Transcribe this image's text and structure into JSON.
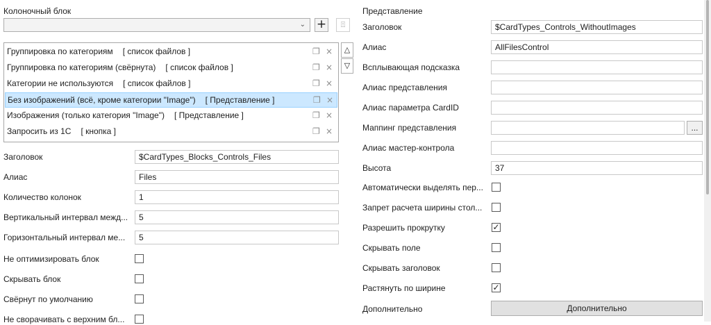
{
  "left": {
    "section_title": "Колоночный блок",
    "combo_value": "",
    "add_icon": "plus-icon",
    "import_icon": "import-icon",
    "move_up_icon": "arrow-up-icon",
    "move_down_icon": "arrow-down-icon",
    "list_items": [
      {
        "name": "Группировка по категориям",
        "tag": "[ список файлов ]",
        "selected": false
      },
      {
        "name": "Группировка по категориям (свёрнута)",
        "tag": "[ список файлов ]",
        "selected": false
      },
      {
        "name": "Категории не используются",
        "tag": "[ список файлов ]",
        "selected": false
      },
      {
        "name": "Без изображений (всё, кроме категории \"Image\")",
        "tag": "[ Представление ]",
        "selected": true
      },
      {
        "name": "Изображения (только категория \"Image\")",
        "tag": "[ Представление ]",
        "selected": false
      },
      {
        "name": "Запросить из 1С",
        "tag": "[ кнопка ]",
        "selected": false
      }
    ],
    "fields": [
      {
        "label": "Заголовок",
        "value": "$CardTypes_Blocks_Controls_Files"
      },
      {
        "label": "Алиас",
        "value": "Files"
      },
      {
        "label": "Количество колонок",
        "value": "1"
      },
      {
        "label": "Вертикальный интервал межд...",
        "value": "5"
      },
      {
        "label": "Горизонтальный интервал ме...",
        "value": "5"
      }
    ],
    "checks": [
      {
        "label": "Не оптимизировать блок",
        "checked": false
      },
      {
        "label": "Скрывать блок",
        "checked": false
      },
      {
        "label": "Свёрнут по умолчанию",
        "checked": false
      },
      {
        "label": "Не сворачивать с верхним бл...",
        "checked": false
      }
    ]
  },
  "right": {
    "section_title": "Представление",
    "fields": [
      {
        "label": "Заголовок",
        "value": "$CardTypes_Controls_WithoutImages"
      },
      {
        "label": "Алиас",
        "value": "AllFilesControl"
      },
      {
        "label": "Всплывающая подсказка",
        "value": ""
      },
      {
        "label": "Алиас представления",
        "value": ""
      },
      {
        "label": "Алиас параметра CardID",
        "value": ""
      },
      {
        "label": "Маппинг представления",
        "value": "",
        "button": "..."
      },
      {
        "label": "Алиас мастер-контрола",
        "value": ""
      },
      {
        "label": "Высота",
        "value": "37"
      }
    ],
    "checks": [
      {
        "label": "Автоматически выделять пер...",
        "checked": false
      },
      {
        "label": "Запрет расчета ширины стол...",
        "checked": false
      },
      {
        "label": "Разрешить прокрутку",
        "checked": true
      },
      {
        "label": "Скрывать поле",
        "checked": false
      },
      {
        "label": "Скрывать заголовок",
        "checked": false
      },
      {
        "label": "Растянуть по ширине",
        "checked": true
      }
    ],
    "extra_label": "Дополнительно",
    "extra_button": "Дополнительно"
  }
}
